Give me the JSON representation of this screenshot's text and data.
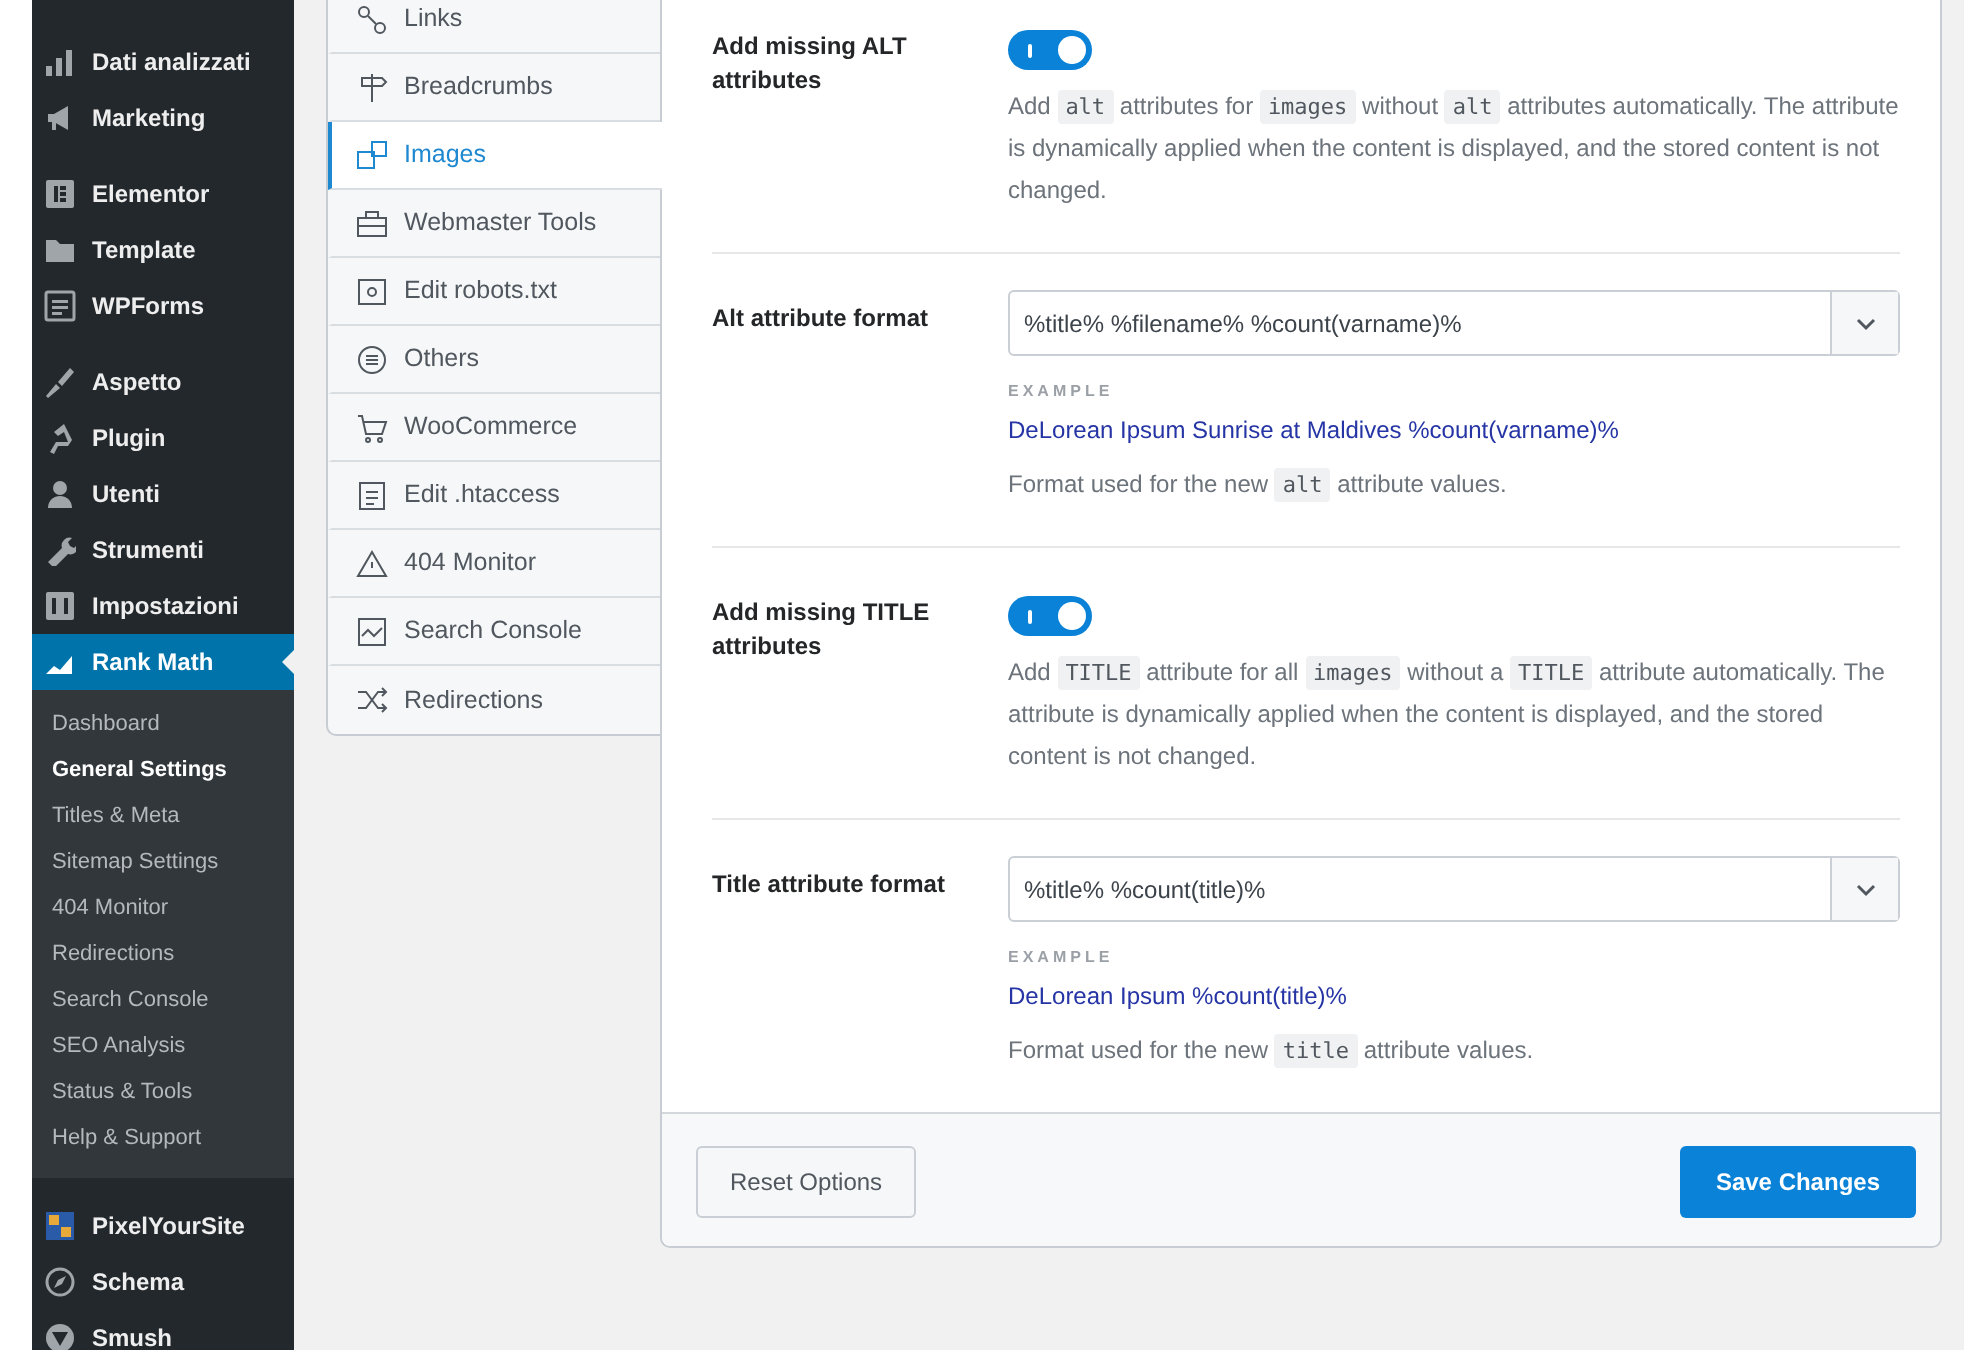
{
  "sidebar": {
    "groups": [
      [
        {
          "label": "Dati analizzati",
          "selected": false
        },
        {
          "label": "Marketing",
          "selected": false
        }
      ],
      [
        {
          "label": "Elementor",
          "selected": false
        },
        {
          "label": "Template",
          "selected": false
        },
        {
          "label": "WPForms",
          "selected": false
        }
      ],
      [
        {
          "label": "Aspetto",
          "selected": false
        },
        {
          "label": "Plugin",
          "selected": false
        },
        {
          "label": "Utenti",
          "selected": false
        },
        {
          "label": "Strumenti",
          "selected": false
        },
        {
          "label": "Impostazioni",
          "selected": false
        },
        {
          "label": "Rank Math",
          "selected": true,
          "submenu": [
            {
              "label": "Dashboard",
              "selected": false
            },
            {
              "label": "General Settings",
              "selected": true
            },
            {
              "label": "Titles & Meta",
              "selected": false
            },
            {
              "label": "Sitemap Settings",
              "selected": false
            },
            {
              "label": "404 Monitor",
              "selected": false
            },
            {
              "label": "Redirections",
              "selected": false
            },
            {
              "label": "Search Console",
              "selected": false
            },
            {
              "label": "SEO Analysis",
              "selected": false
            },
            {
              "label": "Status & Tools",
              "selected": false
            },
            {
              "label": "Help & Support",
              "selected": false
            }
          ]
        }
      ],
      [
        {
          "label": "PixelYourSite",
          "selected": false
        },
        {
          "label": "Schema",
          "selected": false
        },
        {
          "label": "Smush",
          "selected": false
        }
      ]
    ]
  },
  "settings_nav": [
    {
      "label": "Links",
      "selected": false
    },
    {
      "label": "Breadcrumbs",
      "selected": false
    },
    {
      "label": "Images",
      "selected": true
    },
    {
      "label": "Webmaster Tools",
      "selected": false
    },
    {
      "label": "Edit robots.txt",
      "selected": false
    },
    {
      "label": "Others",
      "selected": false
    },
    {
      "label": "WooCommerce",
      "selected": false
    },
    {
      "label": "Edit .htaccess",
      "selected": false
    },
    {
      "label": "404 Monitor",
      "selected": false
    },
    {
      "label": "Search Console",
      "selected": false
    },
    {
      "label": "Redirections",
      "selected": false
    }
  ],
  "settings": [
    {
      "kind": "toggle",
      "label": "Add missing ALT attributes",
      "on": true,
      "description": [
        {
          "kind": "text",
          "text": "Add "
        },
        {
          "kind": "code",
          "text": "alt"
        },
        {
          "kind": "text",
          "text": " attributes for "
        },
        {
          "kind": "code",
          "text": "images"
        },
        {
          "kind": "text",
          "text": " without "
        },
        {
          "kind": "code",
          "text": "alt"
        },
        {
          "kind": "text",
          "text": " attributes automatically. The attribute is dynamically applied when the content is displayed, and the stored content is not changed."
        }
      ]
    },
    {
      "kind": "select",
      "label": "Alt attribute format",
      "value": "%title% %filename% %count(varname)%",
      "example_label": "EXAMPLE",
      "example": "DeLorean Ipsum Sunrise at Maldives %count(varname)%",
      "description": [
        {
          "kind": "text",
          "text": "Format used for the new "
        },
        {
          "kind": "code",
          "text": "alt"
        },
        {
          "kind": "text",
          "text": " attribute values."
        }
      ]
    },
    {
      "kind": "toggle",
      "label": "Add missing TITLE attributes",
      "on": true,
      "description": [
        {
          "kind": "text",
          "text": "Add "
        },
        {
          "kind": "code",
          "text": "TITLE"
        },
        {
          "kind": "text",
          "text": " attribute for all "
        },
        {
          "kind": "code",
          "text": "images"
        },
        {
          "kind": "text",
          "text": " without a "
        },
        {
          "kind": "code",
          "text": "TITLE"
        },
        {
          "kind": "text",
          "text": " attribute automatically. The attribute is dynamically applied when the content is displayed, and the stored content is not changed."
        }
      ]
    },
    {
      "kind": "select",
      "label": "Title attribute format",
      "value": "%title% %count(title)%",
      "example_label": "EXAMPLE",
      "example": "DeLorean Ipsum %count(title)%",
      "description": [
        {
          "kind": "text",
          "text": "Format used for the new "
        },
        {
          "kind": "code",
          "text": "title"
        },
        {
          "kind": "text",
          "text": " attribute values."
        }
      ]
    }
  ],
  "footer": {
    "reset_button": "Reset Options",
    "save_button": "Save Changes"
  }
}
